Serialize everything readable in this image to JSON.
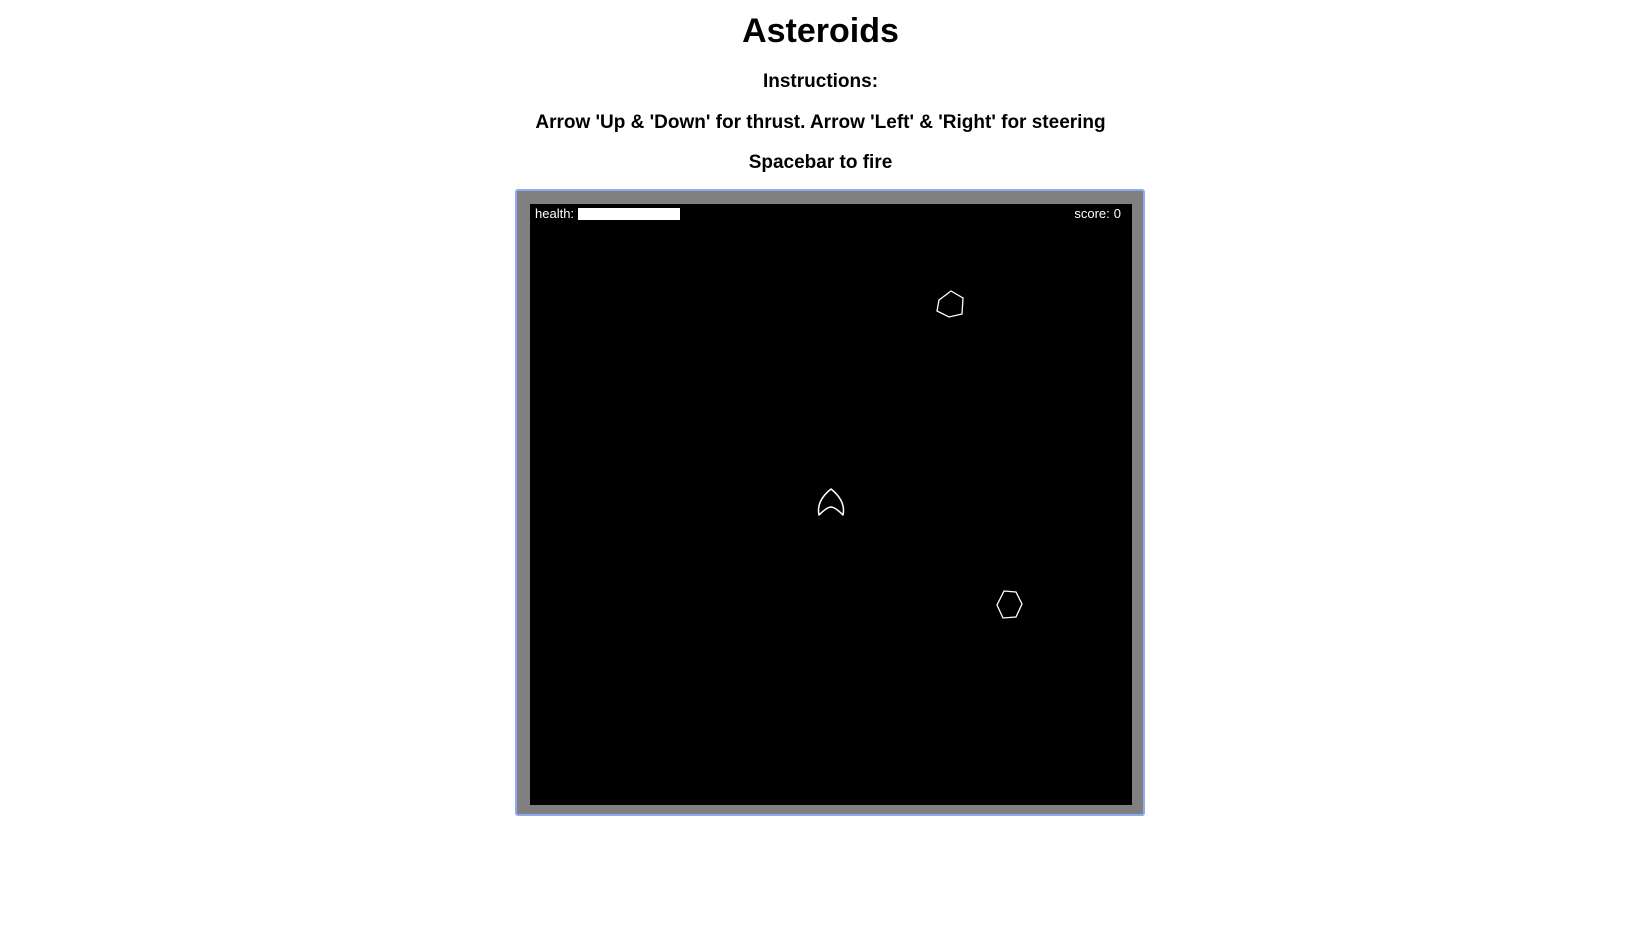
{
  "page": {
    "title": "Asteroids",
    "instructions_heading": "Instructions:",
    "instructions_line1": "Arrow 'Up & 'Down' for thrust. Arrow 'Left' & 'Right' for steering",
    "instructions_line2": "Spacebar to fire"
  },
  "hud": {
    "health_label": "health:",
    "health_level": 1.0,
    "score_label": "score:",
    "score_value": "0"
  },
  "colors": {
    "frame_border": "#8eaaf0",
    "frame_fill": "#808080",
    "space": "#000000",
    "lines": "#ffffff"
  },
  "entities": {
    "ship": "ship-icon",
    "asteroids": [
      "asteroid-icon",
      "asteroid-icon"
    ]
  }
}
